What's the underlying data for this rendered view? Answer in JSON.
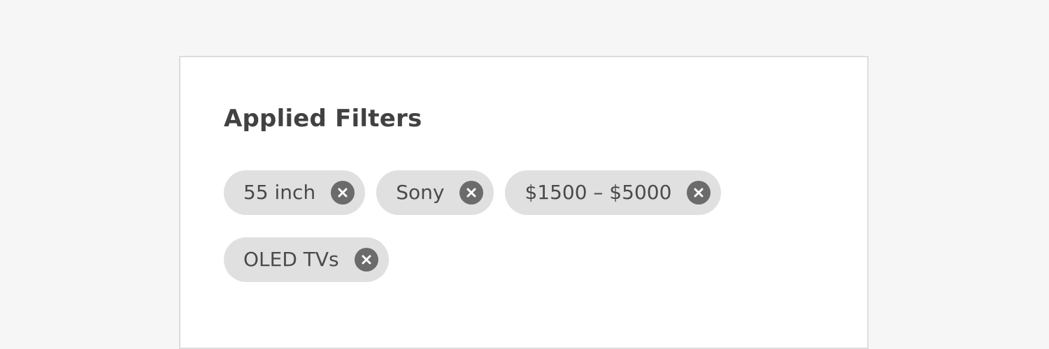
{
  "applied_filters": {
    "title": "Applied Filters",
    "chips": [
      {
        "label": "55 inch",
        "remove_icon": "close-icon"
      },
      {
        "label": "Sony",
        "remove_icon": "close-icon"
      },
      {
        "label": "$1500 – $5000",
        "remove_icon": "close-icon"
      },
      {
        "label": "OLED TVs",
        "remove_icon": "close-icon"
      }
    ]
  },
  "colors": {
    "page_background": "#f6f6f6",
    "panel_background": "#ffffff",
    "panel_border": "#dddddd",
    "chip_background": "#e0e0e0",
    "chip_text": "#4a4a4a",
    "close_icon_background": "#6b6b6b",
    "title_text": "#414141"
  }
}
